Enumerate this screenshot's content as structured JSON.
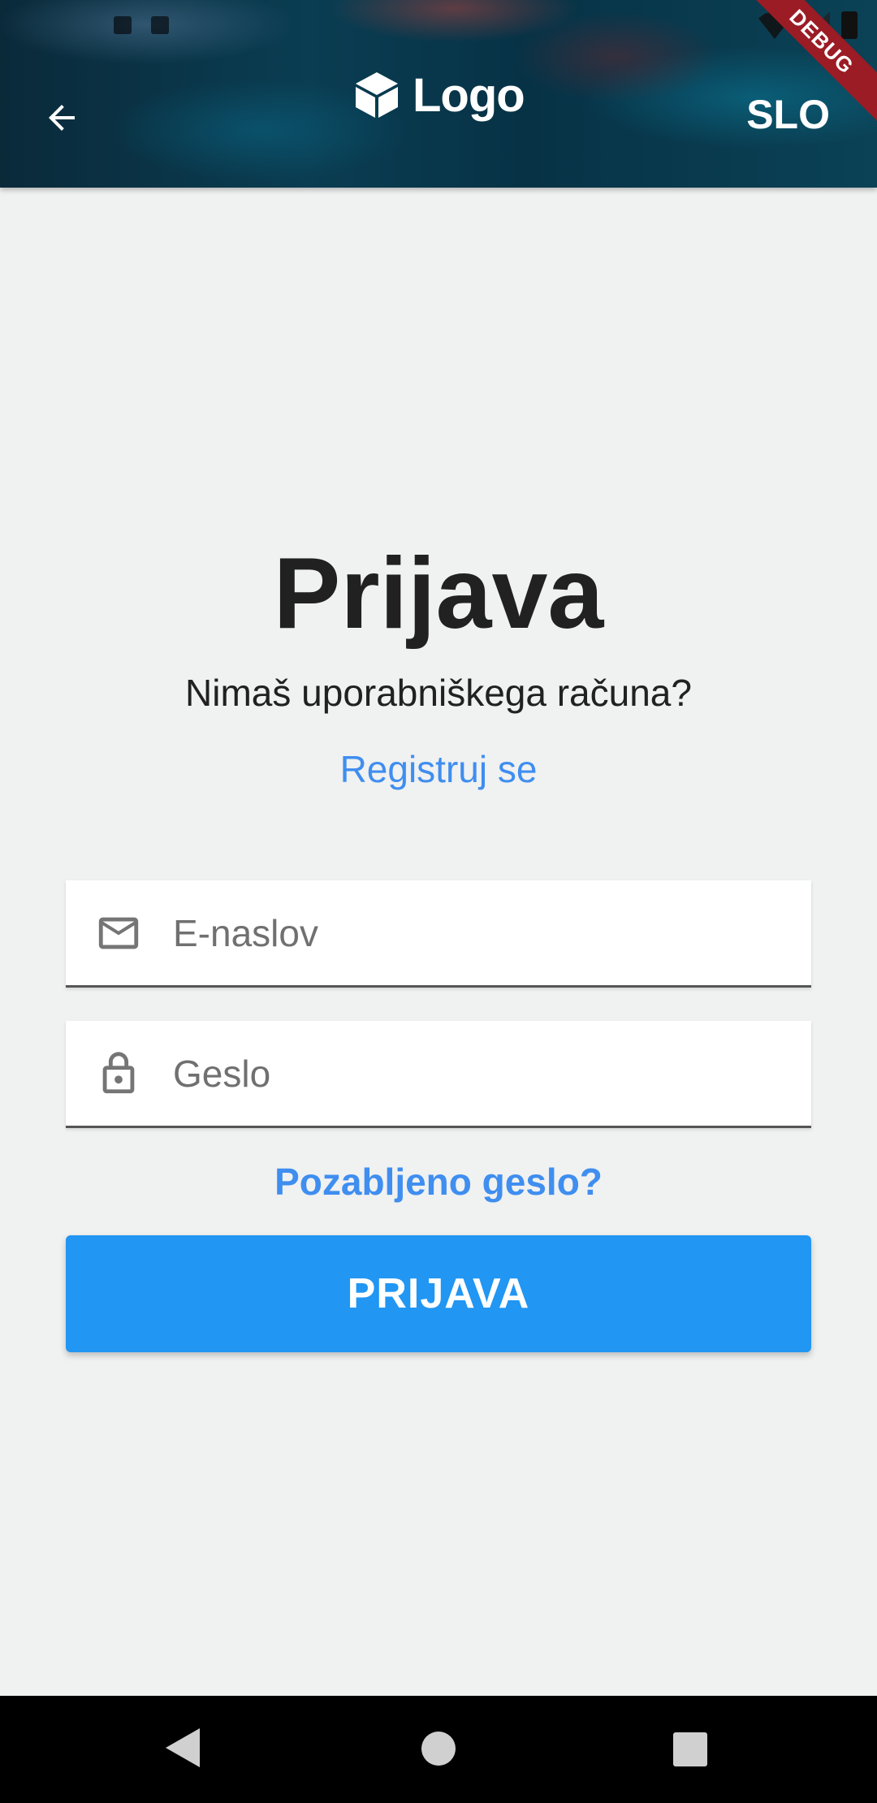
{
  "header": {
    "logo_text": "Logo",
    "language_label": "SLO",
    "debug_label": "DEBUG",
    "back_icon": "arrow-left-icon",
    "logo_icon": "cube-icon"
  },
  "login": {
    "title": "Prijava",
    "no_account_text": "Nimaš uporabniškega računa?",
    "register_link": "Registruj se",
    "email_placeholder": "E-naslov",
    "password_placeholder": "Geslo",
    "forgot_password_link": "Pozabljeno geslo?",
    "submit_label": "PRIJAVA"
  },
  "colors": {
    "accent": "#2196f3",
    "link": "#3f8ef0",
    "background": "#f0f1f1"
  }
}
